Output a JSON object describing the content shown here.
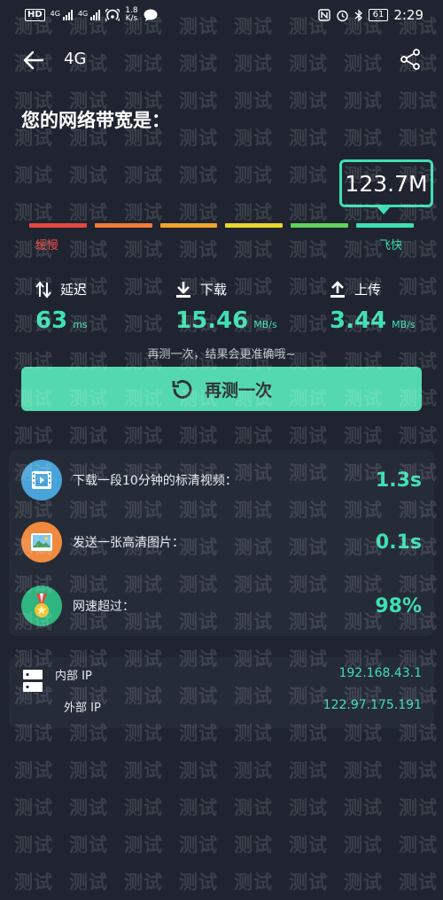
{
  "status_bar": {
    "hd_badge": "HD",
    "net1": "4G",
    "net2": "4G",
    "speed_top": "1.8",
    "speed_bottom": "K/s",
    "battery": "61",
    "time": "2:29"
  },
  "header": {
    "title": "4G"
  },
  "heading": "您的网络带宽是：",
  "bandwidth": {
    "value": "123.7M",
    "slow_label": "缓慢",
    "fast_label": "飞快",
    "segment_colors": [
      "#e5483f",
      "#f27b36",
      "#f2a52c",
      "#e9d62c",
      "#5fd15b",
      "#3ee0b0"
    ]
  },
  "stats": [
    {
      "label": "延迟",
      "value": "63",
      "unit": "ms",
      "icon": "latency-arrows-icon"
    },
    {
      "label": "下载",
      "value": "15.46",
      "unit": "MB/s",
      "icon": "download-icon"
    },
    {
      "label": "上传",
      "value": "3.44",
      "unit": "MB/s",
      "icon": "upload-icon"
    }
  ],
  "hint": "再测一次，结果会更准确哦~",
  "retest_label": "再测一次",
  "info": [
    {
      "label": "下载一段10分钟的标清视频：",
      "value": "1.3s",
      "icon": "video-icon",
      "color": "#4aa3d8"
    },
    {
      "label": "发送一张高清图片：",
      "value": "0.1s",
      "icon": "image-icon",
      "color": "#f08a3e"
    },
    {
      "label": "网速超过：",
      "value": "98%",
      "icon": "medal-icon",
      "color": "#2fb57f"
    }
  ],
  "ip": {
    "internal_label": "内部 IP",
    "internal_value": "192.168.43.1",
    "external_label": "外部 IP",
    "external_value": "122.97.175.191"
  },
  "watermark": "测试"
}
